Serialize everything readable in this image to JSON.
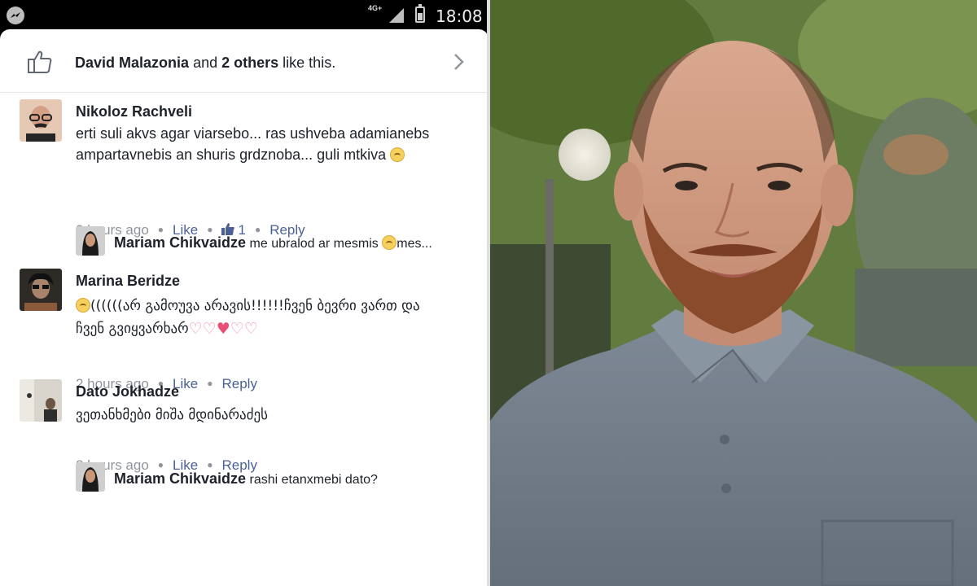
{
  "status_bar": {
    "network": "4G+",
    "time": "18:08"
  },
  "likes": {
    "name": "David Malazonia",
    "and": "and",
    "others": "2 others",
    "suffix": "like this."
  },
  "comments": [
    {
      "author": "Nikoloz Rachveli",
      "text": "erti suli akvs agar viarsebo... ras ushveba adamianebs ampartavnebis an shuris grdznoba... guli mtkiva",
      "time": "3 hours ago",
      "like_label": "Like",
      "like_count": "1",
      "reply_label": "Reply",
      "reply": {
        "author": "Mariam Chikvaidze",
        "text": "me ubralod ar mesmis",
        "suffix": "mes..."
      }
    },
    {
      "author": "Marina Beridze",
      "text": "((((((არ გამოუვა არავის!!!!!!ჩვენ ბევრი ვართ და ჩვენ გვიყვარხარ",
      "time": "2 hours ago",
      "like_label": "Like",
      "reply_label": "Reply"
    },
    {
      "author": "Dato Jokhadze",
      "text": "ვეთანხმები მიშა მდინარაძეს",
      "time": "2 hours ago",
      "like_label": "Like",
      "reply_label": "Reply",
      "reply": {
        "author": "Mariam Chikvaidze",
        "text": "rashi etanxmebi dato?"
      }
    }
  ],
  "icons": {
    "like_thumb": "thumbs-up-outline-icon",
    "chevron": "chevron-right-icon",
    "like_count_icon": "thumbs-up-filled-icon"
  },
  "colors": {
    "link": "#4b6196",
    "meta": "#90949c",
    "text": "#1d2129"
  }
}
